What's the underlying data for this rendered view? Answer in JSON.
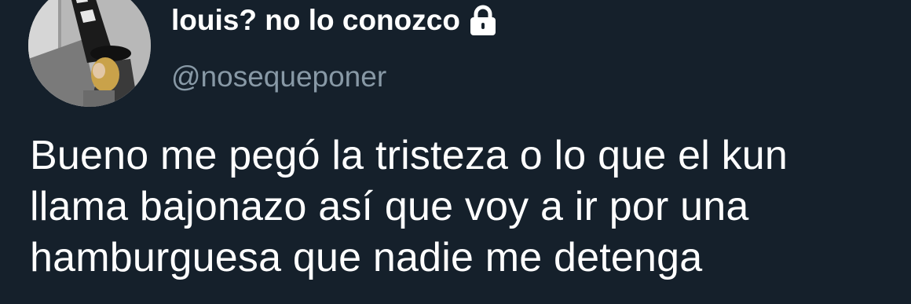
{
  "author": {
    "display_name": "louis? no lo conozco",
    "handle": "@nosequeponer",
    "protected_icon": "lock-icon",
    "avatar": "profile-avatar"
  },
  "tweet": {
    "text_lines": [
      "Bueno me pegó la tristeza o lo que el kun",
      "llama bajonazo así que voy a ir por una",
      "hamburguesa que nadie me detenga"
    ]
  },
  "colors": {
    "background": "#15202b",
    "name": "#ffffff",
    "handle": "#8899a6",
    "text": "#ffffff"
  }
}
